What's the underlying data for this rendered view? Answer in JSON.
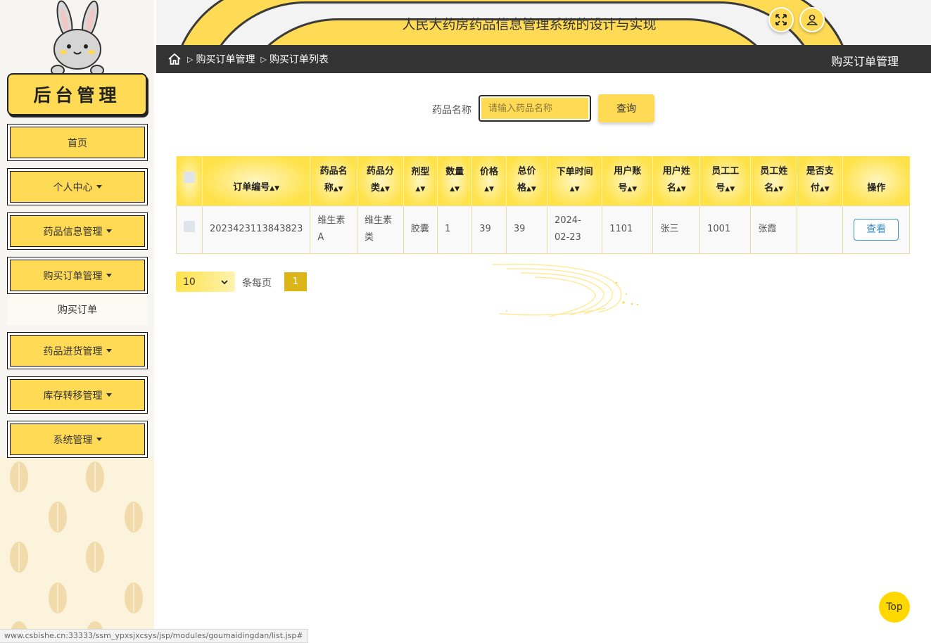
{
  "sidebar": {
    "title": "后台管理",
    "menu": [
      {
        "label": "首页"
      },
      {
        "label": "个人中心"
      },
      {
        "label": "药品信息管理"
      },
      {
        "label": "购买订单管理"
      },
      {
        "label": "药品进货管理"
      },
      {
        "label": "库存转移管理"
      },
      {
        "label": "系统管理"
      }
    ],
    "active_submenu": "购买订单"
  },
  "header": {
    "title": "人民大药房药品信息管理系统的设计与实现",
    "icons": [
      "fullscreen-icon",
      "user-icon"
    ]
  },
  "breadcrumb": {
    "items": [
      "购买订单管理",
      "购买订单列表"
    ],
    "right_title": "购买订单管理"
  },
  "search": {
    "label": "药品名称",
    "placeholder": "请输入药品名称",
    "button": "查询"
  },
  "table": {
    "headers": [
      {
        "line1": "订单编号",
        "line2": ""
      },
      {
        "line1": "药品名",
        "line2": "称"
      },
      {
        "line1": "药品分",
        "line2": "类"
      },
      {
        "line1": "剂型",
        "line2": ""
      },
      {
        "line1": "数量",
        "line2": ""
      },
      {
        "line1": "价格",
        "line2": ""
      },
      {
        "line1": "总价",
        "line2": "格"
      },
      {
        "line1": "下单时间",
        "line2": ""
      },
      {
        "line1": "用户账",
        "line2": "号"
      },
      {
        "line1": "用户姓",
        "line2": "名"
      },
      {
        "line1": "员工工",
        "line2": "号"
      },
      {
        "line1": "员工姓",
        "line2": "名"
      },
      {
        "line1": "是否支",
        "line2": "付"
      }
    ],
    "action_header": "操作",
    "rows": [
      {
        "order_no": "2023423113843823",
        "drug_name": "维生素A",
        "drug_category": "维生素类",
        "dosage_form": "胶囊",
        "quantity": "1",
        "price": "39",
        "total": "39",
        "order_time": "2024-02-23",
        "user_account": "1101",
        "user_name": "张三",
        "staff_no": "1001",
        "staff_name": "张霞",
        "paid": "",
        "action_label": "查看"
      }
    ]
  },
  "pagination": {
    "page_size": "10",
    "per_page_label": "条每页",
    "current_page": "1"
  },
  "top_button": "Top",
  "status_url": "www.csbishe.cn:33333/ssm_ypxsjxcsys/jsp/modules/goumaidingdan/list.jsp#",
  "colors": {
    "accent": "#ffdb55",
    "dark_bar": "#333333",
    "link": "#3b8fc4"
  }
}
